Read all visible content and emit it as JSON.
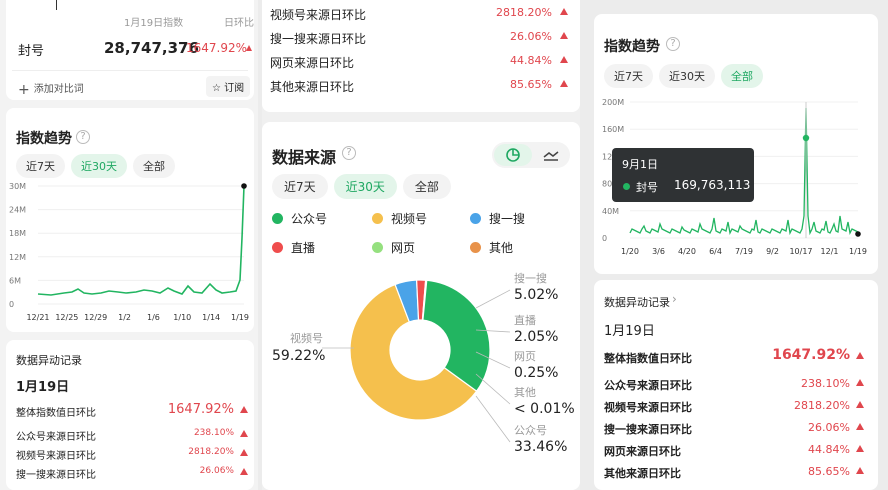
{
  "left": {
    "top_header": {
      "date_label": "1月19日指数",
      "change_label": "日环比"
    },
    "keyword": "封号",
    "index_value": "28,747,376",
    "index_change": "1647.92%",
    "add_compare": "添加对比词",
    "subscribe": "订阅",
    "trend": {
      "title": "指数趋势",
      "help": "?",
      "tabs": [
        "近7天",
        "近30天",
        "全部"
      ],
      "active_tab": 1,
      "y_ticks": [
        "30M",
        "24M",
        "18M",
        "12M",
        "6M",
        "0"
      ],
      "x_ticks": [
        "12/21",
        "12/25",
        "12/29",
        "1/2",
        "1/6",
        "1/10",
        "1/14",
        "1/19"
      ]
    },
    "anomaly": {
      "title": "数据异动记录",
      "chevron": "›",
      "date": "1月19日",
      "rows": [
        {
          "label": "整体指数值日环比",
          "value": "1647.92%"
        },
        {
          "label": "公众号来源日环比",
          "value": "238.10%"
        },
        {
          "label": "视频号来源日环比",
          "value": "2818.20%"
        },
        {
          "label": "搜一搜来源日环比",
          "value": "26.06%"
        }
      ]
    }
  },
  "middle": {
    "top_rows": [
      {
        "label": "视频号来源日环比",
        "value": "2818.20%"
      },
      {
        "label": "搜一搜来源日环比",
        "value": "26.06%"
      },
      {
        "label": "网页来源日环比",
        "value": "44.84%"
      },
      {
        "label": "其他来源日环比",
        "value": "85.65%"
      }
    ],
    "source": {
      "title": "数据来源",
      "help": "?",
      "tabs": [
        "近7天",
        "近30天",
        "全部"
      ],
      "active_tab": 1,
      "legend": [
        {
          "name": "公众号",
          "color": "#22b561"
        },
        {
          "name": "视频号",
          "color": "#f5c04d"
        },
        {
          "name": "搜一搜",
          "color": "#4aa3e8"
        },
        {
          "name": "直播",
          "color": "#ef4d4d"
        },
        {
          "name": "网页",
          "color": "#95e07f"
        },
        {
          "name": "其他",
          "color": "#e8924a"
        }
      ]
    },
    "chart_data": {
      "type": "pie",
      "categories": [
        "视频号",
        "公众号",
        "搜一搜",
        "直播",
        "网页",
        "其他"
      ],
      "values": [
        59.22,
        33.46,
        5.02,
        2.05,
        0.25,
        0.01
      ],
      "labels": [
        {
          "name": "搜一搜",
          "pct": "5.02%"
        },
        {
          "name": "直播",
          "pct": "2.05%"
        },
        {
          "name": "网页",
          "pct": "0.25%"
        },
        {
          "name": "其他",
          "pct": "< 0.01%"
        },
        {
          "name": "公众号",
          "pct": "33.46%"
        }
      ],
      "left_label": {
        "name": "视频号",
        "pct": "59.22%"
      }
    }
  },
  "right": {
    "trend": {
      "title": "指数趋势",
      "help": "?",
      "tabs": [
        "近7天",
        "近30天",
        "全部"
      ],
      "active_tab": 2,
      "y_ticks": [
        "200M",
        "160M",
        "120M",
        "80M",
        "40M",
        "0"
      ],
      "x_ticks": [
        "1/20",
        "3/6",
        "4/20",
        "6/4",
        "7/19",
        "9/2",
        "10/17",
        "12/1",
        "1/19"
      ],
      "tooltip": {
        "date": "9月1日",
        "keyword": "封号",
        "value": "169,763,113"
      }
    },
    "anomaly": {
      "title": "数据异动记录",
      "chevron": "›",
      "date": "1月19日",
      "rows": [
        {
          "label": "整体指数值日环比",
          "value": "1647.92%"
        },
        {
          "label": "公众号来源日环比",
          "value": "238.10%"
        },
        {
          "label": "视频号来源日环比",
          "value": "2818.20%"
        },
        {
          "label": "搜一搜来源日环比",
          "value": "26.06%"
        },
        {
          "label": "网页来源日环比",
          "value": "44.84%"
        },
        {
          "label": "其他来源日环比",
          "value": "85.65%"
        }
      ]
    }
  }
}
